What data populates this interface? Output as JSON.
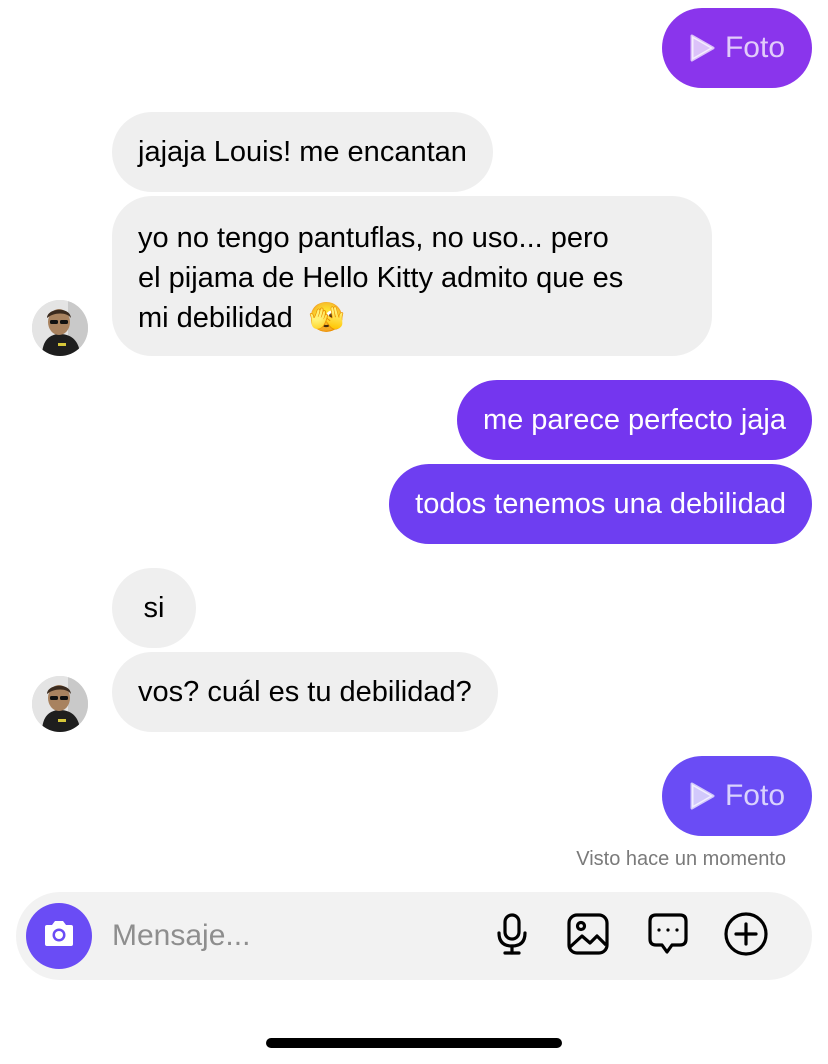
{
  "colors": {
    "received_bg": "#efefef",
    "sent_purple": "#7633f0",
    "sent_indigo": "#6a4cf5",
    "camera_button": "#6a4cf5"
  },
  "messages": {
    "foto_top": {
      "label": "Foto",
      "icon": "play-icon"
    },
    "recv_1": "jajaja Louis! me encantan",
    "recv_2_lines": [
      "yo no tengo pantuflas, no uso... pero",
      "el pijama de Hello Kitty admito que es",
      "mi debilidad"
    ],
    "recv_2_emoji": "🫣",
    "sent_1": "me parece perfecto jaja",
    "sent_2": "todos tenemos una debilidad",
    "recv_3": "si",
    "recv_4": "vos? cuál es tu debilidad?",
    "foto_bottom": {
      "label": "Foto",
      "icon": "play-icon"
    }
  },
  "seen_status": "Visto hace un momento",
  "composer": {
    "placeholder": "Mensaje...",
    "icons": [
      "camera-icon",
      "microphone-icon",
      "gallery-icon",
      "sticker-message-icon",
      "add-circle-icon"
    ]
  }
}
